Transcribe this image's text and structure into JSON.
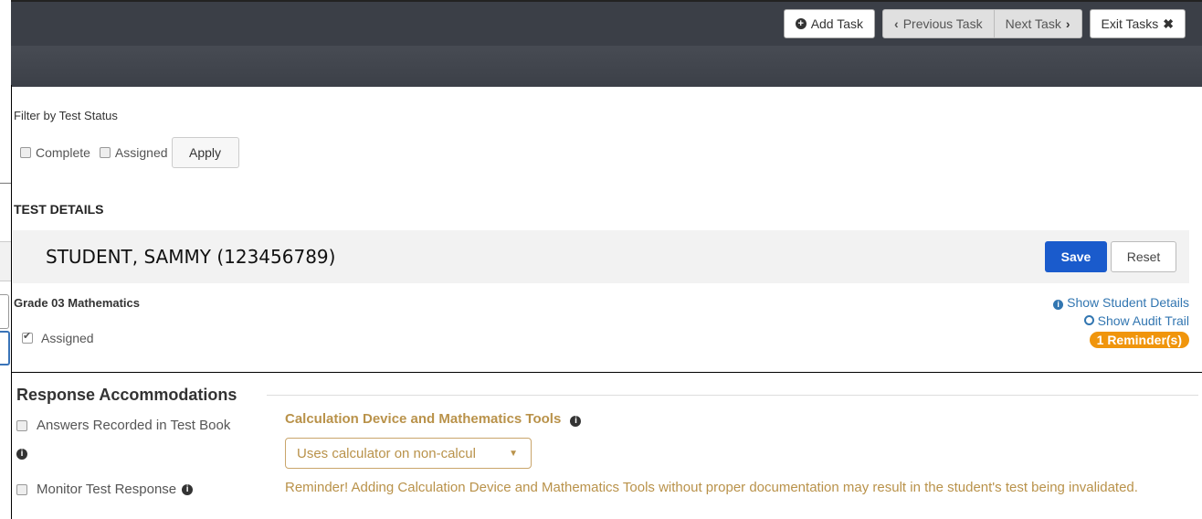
{
  "toolbar": {
    "add_task": "Add Task",
    "previous_task": "Previous Task",
    "next_task": "Next Task",
    "exit_tasks": "Exit Tasks"
  },
  "filter": {
    "label": "Filter by Test Status",
    "complete": "Complete",
    "assigned": "Assigned",
    "apply": "Apply"
  },
  "test_details": {
    "heading": "TEST DETAILS",
    "student": "STUDENT, SAMMY (123456789)",
    "save": "Save",
    "reset": "Reset",
    "grade": "Grade 03 Mathematics",
    "assigned": "Assigned",
    "show_student_details": "Show Student Details",
    "show_audit_trail": "Show Audit Trail",
    "reminders": "1 Reminder(s)"
  },
  "response": {
    "title": "Response Accommodations",
    "answers_recorded": "Answers Recorded in Test Book",
    "monitor": "Monitor Test Response",
    "calc_title": "Calculation Device and Mathematics Tools",
    "calc_value": "Uses calculator on non-calcul",
    "reminder": "Reminder! Adding Calculation Device and Mathematics Tools without proper documentation may result in the student's test being invalidated."
  },
  "colors": {
    "header": "#3b3f47",
    "primary": "#1a5bcc",
    "link": "#3276b1",
    "badge": "#f0950c",
    "warning_text": "#b9924a"
  }
}
